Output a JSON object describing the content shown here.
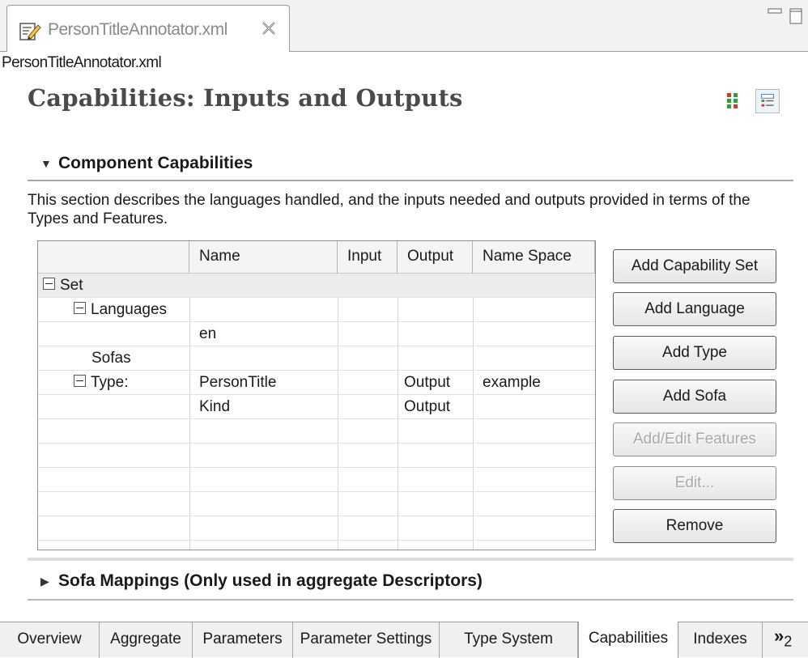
{
  "editor_tab": {
    "label": "PersonTitleAnnotator.xml",
    "icon": "xml-edit-icon"
  },
  "breadcrumb": "PersonTitleAnnotator.xml",
  "page_title": "Capabilities: Inputs and Outputs",
  "component_capabilities": {
    "title": "Component Capabilities",
    "description": "This section describes the languages handled, and the inputs needed and outputs provided in terms of the Types and Features.",
    "columns": [
      "",
      "Name",
      "Input",
      "Output",
      "Name Space"
    ],
    "rows": [
      {
        "label": "Set",
        "expander": true,
        "indent": 0,
        "name": "",
        "input": "",
        "output": "",
        "namespace": "",
        "selected": true
      },
      {
        "label": "Languages",
        "expander": true,
        "indent": 1,
        "name": "",
        "input": "",
        "output": "",
        "namespace": ""
      },
      {
        "label": "",
        "expander": false,
        "indent": 0,
        "name": "en",
        "input": "",
        "output": "",
        "namespace": ""
      },
      {
        "label": "Sofas",
        "expander": false,
        "indent": 2,
        "name": "",
        "input": "",
        "output": "",
        "namespace": ""
      },
      {
        "label": "Type:",
        "expander": true,
        "indent": 1,
        "name": "PersonTitle",
        "input": "",
        "output": "Output",
        "namespace": "example"
      },
      {
        "label": "",
        "expander": false,
        "indent": 0,
        "name": "Kind",
        "input": "",
        "output": "Output",
        "namespace": ""
      }
    ]
  },
  "buttons": [
    {
      "label": "Add Capability Set",
      "enabled": true
    },
    {
      "label": "Add Language",
      "enabled": true
    },
    {
      "label": "Add Type",
      "enabled": true
    },
    {
      "label": "Add Sofa",
      "enabled": true
    },
    {
      "label": "Add/Edit Features",
      "enabled": false
    },
    {
      "label": "Edit...",
      "enabled": false
    },
    {
      "label": "Remove",
      "enabled": true
    }
  ],
  "sofa_mappings": {
    "title": "Sofa Mappings (Only used in aggregate Descriptors)"
  },
  "page_tabs": [
    {
      "label": "Overview"
    },
    {
      "label": "Aggregate"
    },
    {
      "label": "Parameters"
    },
    {
      "label": "Parameter Settings"
    },
    {
      "label": "Type System"
    },
    {
      "label": "Capabilities",
      "active": true
    },
    {
      "label": "Indexes"
    }
  ],
  "more_tabs": {
    "symbol": "»",
    "count": "2"
  }
}
